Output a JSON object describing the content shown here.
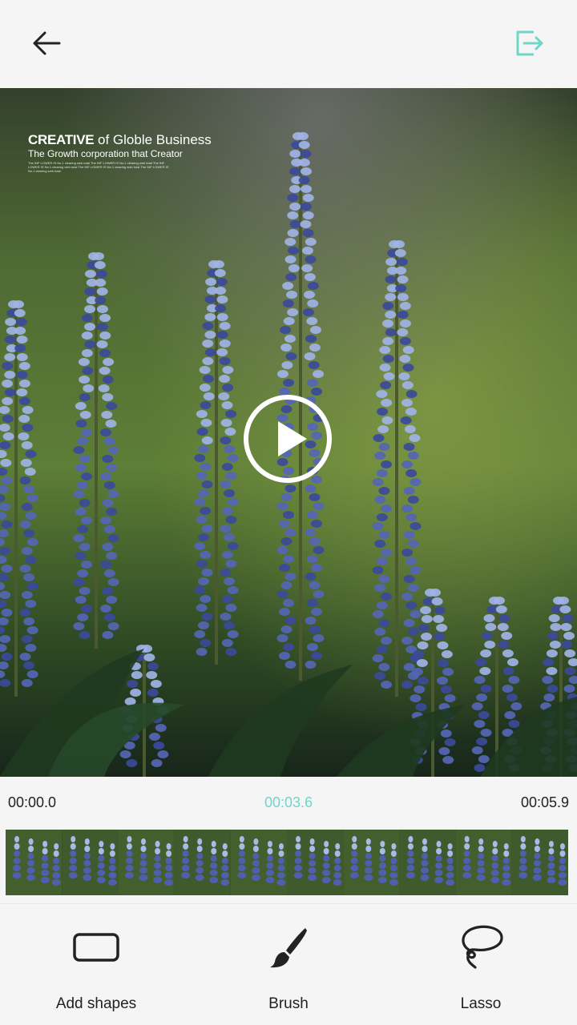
{
  "header": {
    "back_icon": "arrow-left-icon",
    "export_icon": "export-icon",
    "accent_color": "#6fd6c8"
  },
  "video": {
    "overlay": {
      "brand": "CREATIVE",
      "brand_rest": "of Globle Business",
      "tagline": "The Growth corporation that Creator",
      "fine_print": "The INF LOWER IS No.1 clearing web total The INF LOWER IS No.1 clearing web total The INF LOWER IS No.1 clearing web total The INF LOWER IS No.1 clearing web total The INF LOWER IS No.1 clearing web total"
    },
    "play_icon": "play-icon"
  },
  "timeline": {
    "start": "00:00.0",
    "current": "00:03.6",
    "end": "00:05.9",
    "frames": 10
  },
  "tools": [
    {
      "label": "Add shapes",
      "icon": "rounded-rectangle-icon"
    },
    {
      "label": "Brush",
      "icon": "brush-icon"
    },
    {
      "label": "Lasso",
      "icon": "lasso-icon"
    }
  ]
}
